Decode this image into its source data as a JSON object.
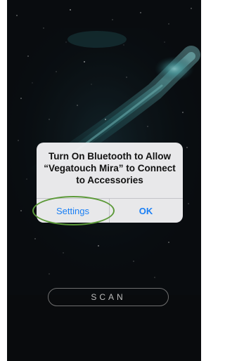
{
  "alert": {
    "title": "Turn On Bluetooth to Allow\n“Vegatouch Mira” to Connect\nto Accessories",
    "settings_label": "Settings",
    "ok_label": "OK"
  },
  "scan_label": "SCAN",
  "colors": {
    "accent": "#1a7ff5",
    "highlight_ring": "#5d9a3a",
    "background": "#0c1014"
  }
}
